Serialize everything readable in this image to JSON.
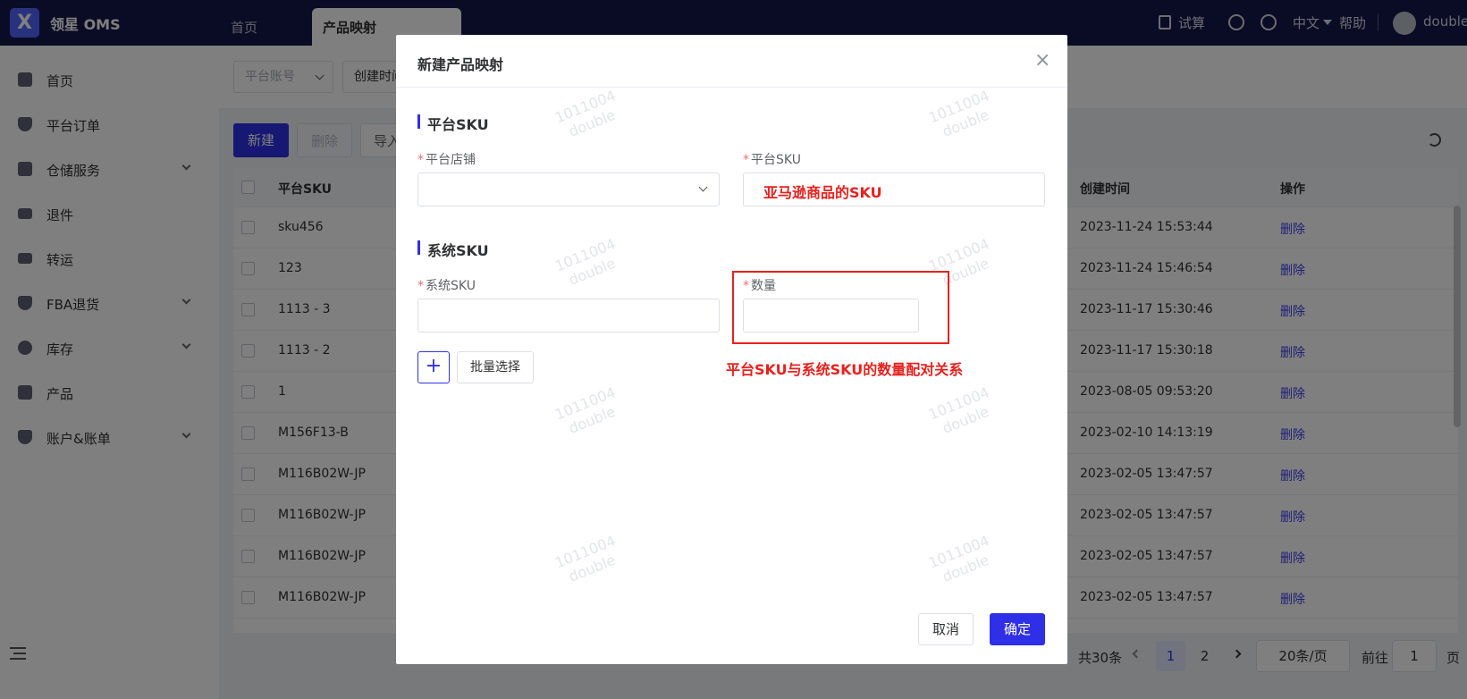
{
  "header": {
    "logo_mark": "X",
    "app_name": "领星 OMS",
    "tabs": [
      {
        "label": "首页"
      },
      {
        "label": "产品映射"
      }
    ],
    "trial": "试算",
    "language": "中文",
    "help": "帮助",
    "username": "double"
  },
  "sidebar": {
    "items": [
      {
        "label": "首页"
      },
      {
        "label": "平台订单"
      },
      {
        "label": "仓储服务"
      },
      {
        "label": "退件"
      },
      {
        "label": "转运"
      },
      {
        "label": "FBA退货"
      },
      {
        "label": "库存"
      },
      {
        "label": "产品"
      },
      {
        "label": "账户&账单"
      }
    ]
  },
  "filters": {
    "platform_account": "平台账号",
    "created_time": "创建时间"
  },
  "toolbar": {
    "new_label": "新建",
    "delete_label": "删除",
    "import_label": "导入"
  },
  "table": {
    "headers": {
      "platform_sku": "平台SKU",
      "created_time": "创建时间",
      "actions": "操作"
    },
    "delete_label": "删除",
    "rows": [
      {
        "sku": "sku456",
        "time": "2023-11-24 15:53:44"
      },
      {
        "sku": "123",
        "time": "2023-11-24 15:46:54"
      },
      {
        "sku": "1113 - 3",
        "time": "2023-11-17 15:30:46"
      },
      {
        "sku": "1113 - 2",
        "time": "2023-11-17 15:30:18"
      },
      {
        "sku": "1",
        "time": "2023-08-05 09:53:20"
      },
      {
        "sku": "M156F13-B",
        "time": "2023-02-10 14:13:19"
      },
      {
        "sku": "M116B02W-JP",
        "time": "2023-02-05 13:47:57"
      },
      {
        "sku": "M116B02W-JP",
        "time": "2023-02-05 13:47:57"
      },
      {
        "sku": "M116B02W-JP",
        "time": "2023-02-05 13:47:57"
      },
      {
        "sku": "M116B02W-JP",
        "time": "2023-02-05 13:47:57"
      }
    ]
  },
  "pagination": {
    "total": "共30条",
    "page1": "1",
    "page2": "2",
    "page_size": "20条/页",
    "goto_label": "前往",
    "goto_value": "1",
    "page_suffix": "页"
  },
  "dialog": {
    "title": "新建产品映射",
    "close": "×",
    "section_platform": "平台SKU",
    "label_store": "平台店铺",
    "label_platform_sku": "平台SKU",
    "platform_sku_annotation": "亚马逊商品的SKU",
    "section_system": "系统SKU",
    "label_system_sku": "系统SKU",
    "label_quantity": "数量",
    "plus_label": "+",
    "batch_select": "批量选择",
    "quantity_annotation": "平台SKU与系统SKU的数量配对关系",
    "cancel": "取消",
    "confirm": "确定",
    "required_mark": "*"
  },
  "watermark": {
    "line1": "1011004",
    "line2": "double"
  },
  "colors": {
    "primary": "#2f2fe8",
    "header_bg": "#15174a",
    "annotation_red": "#e8211e"
  }
}
